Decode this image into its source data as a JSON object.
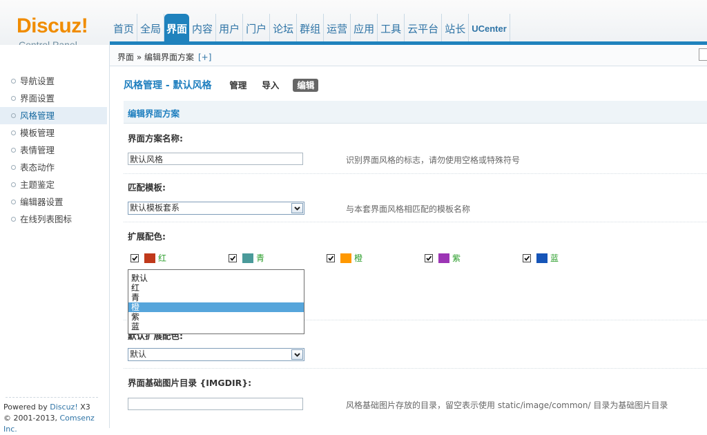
{
  "brand": {
    "logo": "Discuz!",
    "subtitle": "Control Panel"
  },
  "nav": {
    "items": [
      "首页",
      "全局",
      "界面",
      "内容",
      "用户",
      "门户",
      "论坛",
      "群组",
      "运营",
      "应用",
      "工具",
      "云平台",
      "站长",
      "UCenter"
    ],
    "active": "界面"
  },
  "crumb": {
    "path": "界面 » 编辑界面方案",
    "add": "[+]"
  },
  "sidebar": {
    "items": [
      "导航设置",
      "界面设置",
      "风格管理",
      "模板管理",
      "表情管理",
      "表态动作",
      "主题鉴定",
      "编辑器设置",
      "在线列表图标"
    ],
    "active": "风格管理"
  },
  "footer": {
    "powered_prefix": "Powered by ",
    "powered_link": "Discuz!",
    "powered_ver": " X3",
    "copy_prefix": "© 2001-2013, ",
    "copy_link": "Comsenz Inc."
  },
  "main": {
    "title": "风格管理 - 默认风格",
    "tabs": [
      "管理",
      "导入",
      "编辑"
    ],
    "active_tab": "编辑",
    "section": "编辑界面方案",
    "fields": {
      "scheme_name": {
        "label": "界面方案名称:",
        "value": "默认风格",
        "hint": "识别界面风格的标志，请勿使用空格或特殊符号"
      },
      "template": {
        "label": "匹配模板:",
        "value": "默认模板套系",
        "hint": "与本套界面风格相匹配的模板名称"
      },
      "ext_colors": {
        "label": "扩展配色:"
      },
      "default_color": {
        "label": "默认扩展配色:",
        "value": "默认"
      },
      "imgdir": {
        "label": "界面基础图片目录 {IMGDIR}:",
        "value": "",
        "hint": "风格基础图片存放的目录，留空表示使用  static/image/common/ 目录为基础图片目录"
      }
    },
    "colors": [
      {
        "name": "红",
        "hex": "#c0391b",
        "checked": true
      },
      {
        "name": "青",
        "hex": "#4a9a9a",
        "checked": true
      },
      {
        "name": "橙",
        "hex": "#ff9800",
        "checked": true
      },
      {
        "name": "紫",
        "hex": "#9c35b5",
        "checked": true
      },
      {
        "name": "蓝",
        "hex": "#1655b8",
        "checked": true
      }
    ],
    "color_options": [
      "默认",
      "红",
      "青",
      "橙",
      "紫",
      "蓝"
    ],
    "color_selected": "橙"
  }
}
